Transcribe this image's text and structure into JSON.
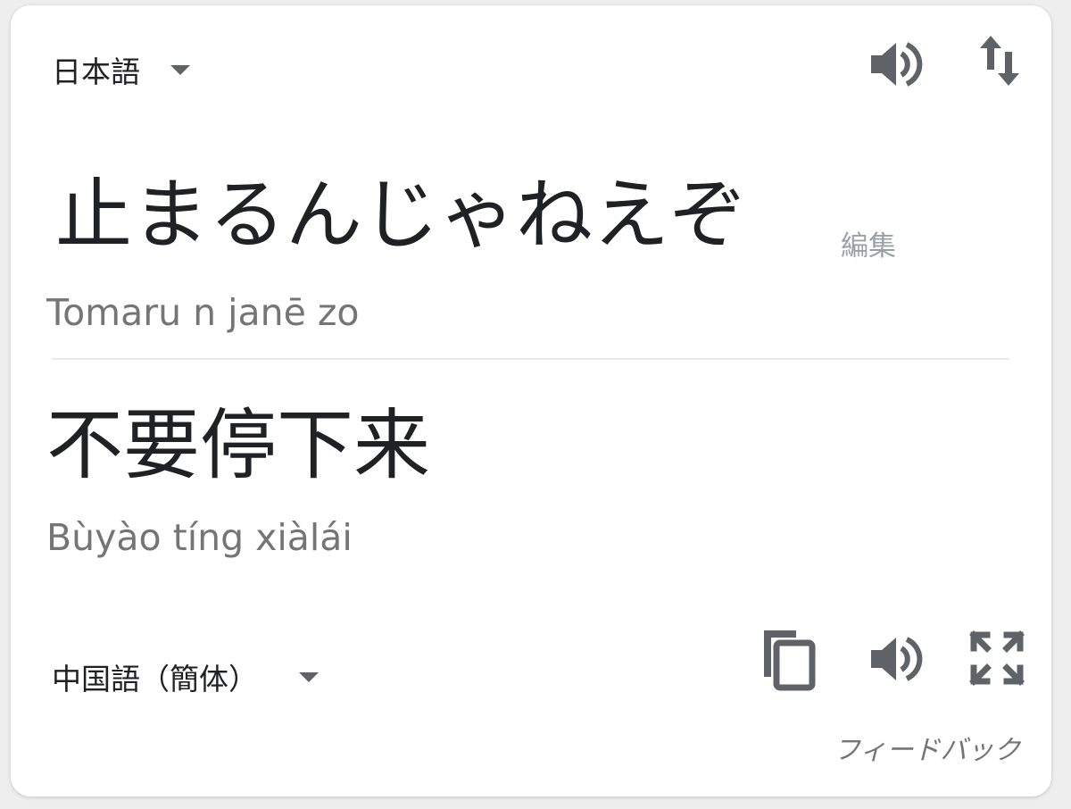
{
  "source": {
    "language": "日本語",
    "text": "止まるんじゃねえぞ",
    "edit_label": "編集",
    "romanization": "Tomaru n janē zo"
  },
  "target": {
    "language": "中国語（簡体）",
    "text": "不要停下来",
    "romanization": "Bùyào tíng xiàlái"
  },
  "footer": {
    "feedback_label": "フィードバック"
  },
  "icons": {
    "source_speak": "speaker-icon",
    "swap": "swap-languages-icon",
    "copy": "copy-icon",
    "target_speak": "speaker-icon",
    "expand": "fullscreen-icon"
  },
  "colors": {
    "text_primary": "#202124",
    "text_secondary": "#757575",
    "icon": "#5f6368",
    "divider": "#e8eaed"
  }
}
